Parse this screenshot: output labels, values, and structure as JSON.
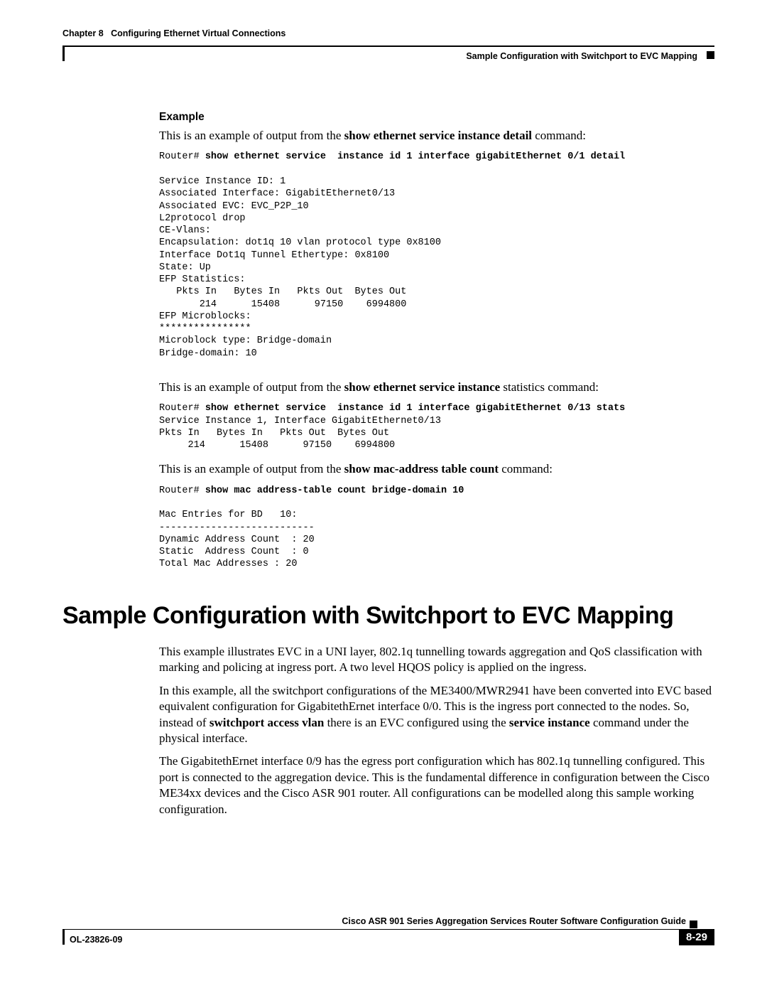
{
  "header": {
    "chapter_prefix": "Chapter 8",
    "chapter_title": "Configuring Ethernet Virtual Connections",
    "section": "Sample Configuration with Switchport to EVC Mapping"
  },
  "example": {
    "heading": "Example",
    "intro1_pre": "This is an example of output from the ",
    "intro1_bold": "show ethernet service instance detail",
    "intro1_post": " command:",
    "code1_prompt": "Router# ",
    "code1_cmd": "show ethernet service  instance id 1 interface gigabitEthernet 0/1 detail",
    "code1_body": "\nService Instance ID: 1\nAssociated Interface: GigabitEthernet0/13\nAssociated EVC: EVC_P2P_10\nL2protocol drop\nCE-Vlans:\nEncapsulation: dot1q 10 vlan protocol type 0x8100\nInterface Dot1q Tunnel Ethertype: 0x8100\nState: Up\nEFP Statistics:\n   Pkts In   Bytes In   Pkts Out  Bytes Out\n       214      15408      97150    6994800\nEFP Microblocks:\n****************\nMicroblock type: Bridge-domain\nBridge-domain: 10",
    "intro2_pre": "This is an example of output from the ",
    "intro2_bold": "show ethernet service instance",
    "intro2_post": " statistics command:",
    "code2_prompt": "Router# ",
    "code2_cmd": "show ethernet service  instance id 1 interface gigabitEthernet 0/13 stats",
    "code2_body": "Service Instance 1, Interface GigabitEthernet0/13\nPkts In   Bytes In   Pkts Out  Bytes Out\n     214      15408      97150    6994800",
    "intro3_pre": "This is an example of output from the ",
    "intro3_bold": "show mac-address table count",
    "intro3_post": " command:",
    "code3_prompt": "Router# ",
    "code3_cmd": "show mac address-table count bridge-domain 10",
    "code3_body": "\nMac Entries for BD   10:\n---------------------------\nDynamic Address Count  : 20\nStatic  Address Count  : 0\nTotal Mac Addresses : 20"
  },
  "section": {
    "title": "Sample Configuration with Switchport to EVC Mapping",
    "p1": "This example illustrates EVC in a UNI layer, 802.1q tunnelling towards aggregation and QoS classification with marking and policing at ingress port. A two level HQOS policy is applied on the ingress.",
    "p2_a": "In this example, all the switchport configurations of the ME3400/MWR2941 have been converted into EVC based equivalent configuration for GigabitethErnet interface 0/0. This is the ingress port connected to the nodes. So, instead of ",
    "p2_b1": "switchport access vlan",
    "p2_c": " there is an EVC configured using the ",
    "p2_b2": "service instance",
    "p2_d": " command under the physical interface.",
    "p3": "The GigabitethErnet interface 0/9 has the egress port configuration which has 802.1q tunnelling configured. This port is connected to the aggregation device. This is the fundamental difference in configuration between the Cisco ME34xx devices and the Cisco ASR 901 router. All configurations can be modelled along this sample working configuration."
  },
  "footer": {
    "book": "Cisco ASR 901 Series Aggregation Services Router Software Configuration Guide",
    "doc_id": "OL-23826-09",
    "page": "8-29"
  }
}
